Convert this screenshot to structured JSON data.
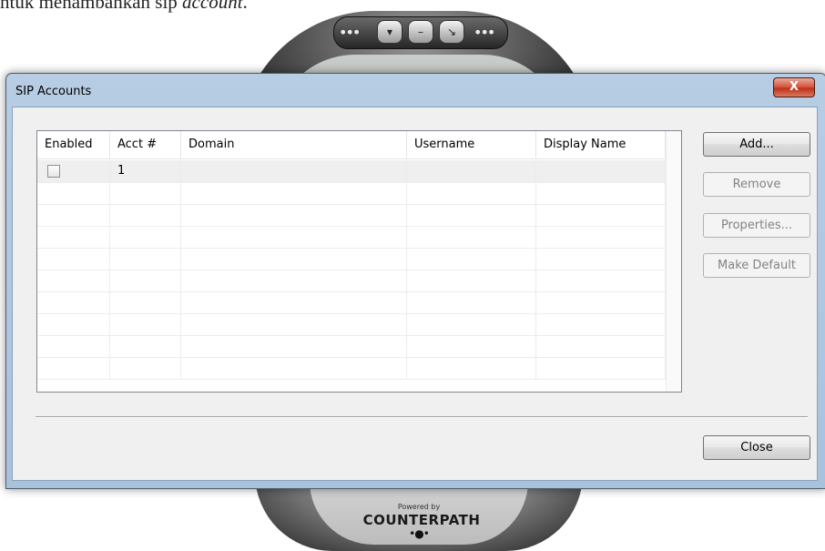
{
  "document": {
    "text_prefix": "ntuk menambahkan sip ",
    "text_italic": "account",
    "text_suffix": "."
  },
  "phone": {
    "powered_by": "Powered by",
    "brand": "COUNTERPATH",
    "icons": [
      "minimize-down-icon",
      "minus-icon",
      "dock-icon"
    ]
  },
  "window": {
    "title": "SIP Accounts",
    "close_glyph": "X"
  },
  "grid": {
    "columns": [
      "Enabled",
      "Acct #",
      "Domain",
      "Username",
      "Display Name"
    ],
    "rows": [
      {
        "enabled": false,
        "acct": "1",
        "domain": "",
        "username": "",
        "display_name": ""
      }
    ]
  },
  "buttons": {
    "add": "Add...",
    "remove": "Remove",
    "properties": "Properties...",
    "make_default": "Make Default",
    "close": "Close"
  },
  "colors": {
    "title_bar": "#b7cde3",
    "close_button": "#c0301b",
    "dialog_bg": "#f0f0f0"
  }
}
